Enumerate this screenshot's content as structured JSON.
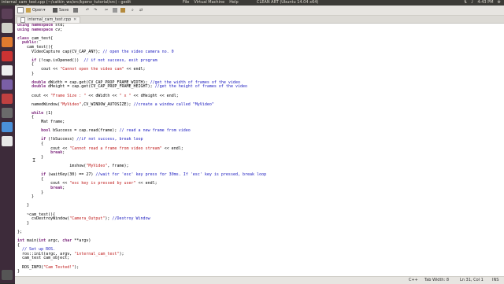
{
  "topbar": {
    "window_title": "internal_cam_test.cpp (~/catkin_ws/src/kpenv_tutorial/src) - gedit",
    "menus": [
      "File",
      "Virtual Machine",
      "Help"
    ],
    "vm_title": "CLEAN ART (Ubuntu 14.04 x64)",
    "clock": "4:43 PM"
  },
  "toolbar": {
    "open_label": "Open",
    "save_label": "Save"
  },
  "tab": {
    "label": "internal_cam_test.cpp"
  },
  "code_lines": [
    "using namespace std;",
    "using namespace cv;",
    "",
    "class cam_test{",
    "  public:",
    "    cam_test(){",
    "      VideoCapture cap(CV_CAP_ANY); // open the video camera no. 0",
    "",
    "      if (!cap.isOpened())  // if not success, exit program",
    "      {",
    "          cout << \"Cannot open the video cam\" << endl;",
    "      }",
    "",
    "      double dWidth = cap.get(CV_CAP_PROP_FRAME_WIDTH); //get the width of frames of the video",
    "      double dHeight = cap.get(CV_CAP_PROP_FRAME_HEIGHT); //get the height of frames of the video",
    "",
    "      cout << \"Frame Size : \" << dWidth << \" x \" << dHeight << endl;",
    "",
    "      namedWindow(\"MyVideo\",CV_WINDOW_AUTOSIZE); //create a window called \"MyVideo\"",
    "",
    "      while (1)",
    "      {",
    "          Mat frame;",
    "",
    "          bool bSuccess = cap.read(frame); // read a new frame from video",
    "",
    "          if (!bSuccess) //if not success, break loop",
    "          {",
    "              cout << \"Cannot read a frame from video stream\" << endl;",
    "              break;",
    "          }",
    "",
    "                      imshow(\"MyVideo\", frame);",
    "",
    "          if (waitKey(30) == 27) //wait for 'esc' key press for 30ms. If 'esc' key is pressed, break loop",
    "          {",
    "              cout << \"esc key is pressed by user\" << endl;",
    "              break;",
    "          }",
    "      }",
    "",
    "    }",
    "",
    "    ~cam_test(){",
    "      cvDestroyWindow(\"Camera_Output\"); //Destroy Window",
    "    }",
    "",
    "};",
    "",
    "int main(int argc, char **argv)",
    "{",
    "  // Set up ROS.",
    "  ros::init(argc, argv, \"internal_cam_test\");",
    "  cam_test cam_object;",
    "",
    "  ROS_INFO(\"Cam Tested!\");",
    "}"
  ],
  "status": {
    "language": "C++",
    "tab_width": "Tab Width: 8",
    "position": "Ln 31, Col 1",
    "mode": "INS"
  },
  "colors": {
    "launcher_bg": "#3d2b3a",
    "topbar_bg": "#3c3b37",
    "keyword": "#7f2b7f",
    "string": "#c02020",
    "comment": "#2020c0"
  }
}
